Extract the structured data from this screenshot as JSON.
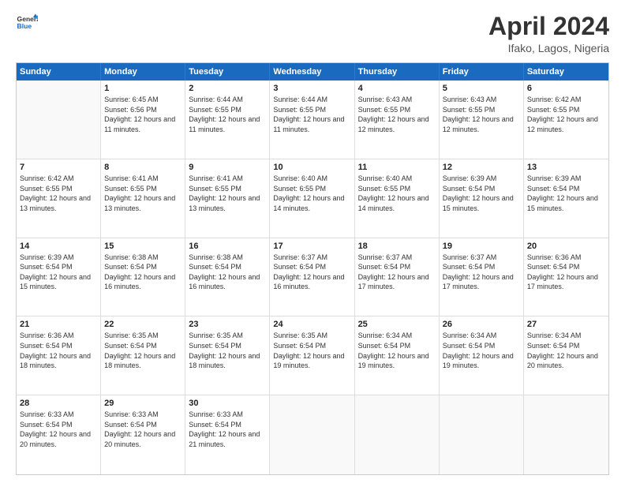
{
  "header": {
    "logo_line1": "General",
    "logo_line2": "Blue",
    "title": "April 2024",
    "subtitle": "Ifako, Lagos, Nigeria"
  },
  "days": [
    "Sunday",
    "Monday",
    "Tuesday",
    "Wednesday",
    "Thursday",
    "Friday",
    "Saturday"
  ],
  "weeks": [
    [
      {
        "day": "",
        "sunrise": "",
        "sunset": "",
        "daylight": ""
      },
      {
        "day": "1",
        "sunrise": "6:45 AM",
        "sunset": "6:56 PM",
        "daylight": "12 hours and 11 minutes."
      },
      {
        "day": "2",
        "sunrise": "6:44 AM",
        "sunset": "6:55 PM",
        "daylight": "12 hours and 11 minutes."
      },
      {
        "day": "3",
        "sunrise": "6:44 AM",
        "sunset": "6:55 PM",
        "daylight": "12 hours and 11 minutes."
      },
      {
        "day": "4",
        "sunrise": "6:43 AM",
        "sunset": "6:55 PM",
        "daylight": "12 hours and 12 minutes."
      },
      {
        "day": "5",
        "sunrise": "6:43 AM",
        "sunset": "6:55 PM",
        "daylight": "12 hours and 12 minutes."
      },
      {
        "day": "6",
        "sunrise": "6:42 AM",
        "sunset": "6:55 PM",
        "daylight": "12 hours and 12 minutes."
      }
    ],
    [
      {
        "day": "7",
        "sunrise": "6:42 AM",
        "sunset": "6:55 PM",
        "daylight": "12 hours and 13 minutes."
      },
      {
        "day": "8",
        "sunrise": "6:41 AM",
        "sunset": "6:55 PM",
        "daylight": "12 hours and 13 minutes."
      },
      {
        "day": "9",
        "sunrise": "6:41 AM",
        "sunset": "6:55 PM",
        "daylight": "12 hours and 13 minutes."
      },
      {
        "day": "10",
        "sunrise": "6:40 AM",
        "sunset": "6:55 PM",
        "daylight": "12 hours and 14 minutes."
      },
      {
        "day": "11",
        "sunrise": "6:40 AM",
        "sunset": "6:55 PM",
        "daylight": "12 hours and 14 minutes."
      },
      {
        "day": "12",
        "sunrise": "6:39 AM",
        "sunset": "6:54 PM",
        "daylight": "12 hours and 15 minutes."
      },
      {
        "day": "13",
        "sunrise": "6:39 AM",
        "sunset": "6:54 PM",
        "daylight": "12 hours and 15 minutes."
      }
    ],
    [
      {
        "day": "14",
        "sunrise": "6:39 AM",
        "sunset": "6:54 PM",
        "daylight": "12 hours and 15 minutes."
      },
      {
        "day": "15",
        "sunrise": "6:38 AM",
        "sunset": "6:54 PM",
        "daylight": "12 hours and 16 minutes."
      },
      {
        "day": "16",
        "sunrise": "6:38 AM",
        "sunset": "6:54 PM",
        "daylight": "12 hours and 16 minutes."
      },
      {
        "day": "17",
        "sunrise": "6:37 AM",
        "sunset": "6:54 PM",
        "daylight": "12 hours and 16 minutes."
      },
      {
        "day": "18",
        "sunrise": "6:37 AM",
        "sunset": "6:54 PM",
        "daylight": "12 hours and 17 minutes."
      },
      {
        "day": "19",
        "sunrise": "6:37 AM",
        "sunset": "6:54 PM",
        "daylight": "12 hours and 17 minutes."
      },
      {
        "day": "20",
        "sunrise": "6:36 AM",
        "sunset": "6:54 PM",
        "daylight": "12 hours and 17 minutes."
      }
    ],
    [
      {
        "day": "21",
        "sunrise": "6:36 AM",
        "sunset": "6:54 PM",
        "daylight": "12 hours and 18 minutes."
      },
      {
        "day": "22",
        "sunrise": "6:35 AM",
        "sunset": "6:54 PM",
        "daylight": "12 hours and 18 minutes."
      },
      {
        "day": "23",
        "sunrise": "6:35 AM",
        "sunset": "6:54 PM",
        "daylight": "12 hours and 18 minutes."
      },
      {
        "day": "24",
        "sunrise": "6:35 AM",
        "sunset": "6:54 PM",
        "daylight": "12 hours and 19 minutes."
      },
      {
        "day": "25",
        "sunrise": "6:34 AM",
        "sunset": "6:54 PM",
        "daylight": "12 hours and 19 minutes."
      },
      {
        "day": "26",
        "sunrise": "6:34 AM",
        "sunset": "6:54 PM",
        "daylight": "12 hours and 19 minutes."
      },
      {
        "day": "27",
        "sunrise": "6:34 AM",
        "sunset": "6:54 PM",
        "daylight": "12 hours and 20 minutes."
      }
    ],
    [
      {
        "day": "28",
        "sunrise": "6:33 AM",
        "sunset": "6:54 PM",
        "daylight": "12 hours and 20 minutes."
      },
      {
        "day": "29",
        "sunrise": "6:33 AM",
        "sunset": "6:54 PM",
        "daylight": "12 hours and 20 minutes."
      },
      {
        "day": "30",
        "sunrise": "6:33 AM",
        "sunset": "6:54 PM",
        "daylight": "12 hours and 21 minutes."
      },
      {
        "day": "",
        "sunrise": "",
        "sunset": "",
        "daylight": ""
      },
      {
        "day": "",
        "sunrise": "",
        "sunset": "",
        "daylight": ""
      },
      {
        "day": "",
        "sunrise": "",
        "sunset": "",
        "daylight": ""
      },
      {
        "day": "",
        "sunrise": "",
        "sunset": "",
        "daylight": ""
      }
    ]
  ],
  "labels": {
    "sunrise": "Sunrise:",
    "sunset": "Sunset:",
    "daylight": "Daylight:"
  }
}
